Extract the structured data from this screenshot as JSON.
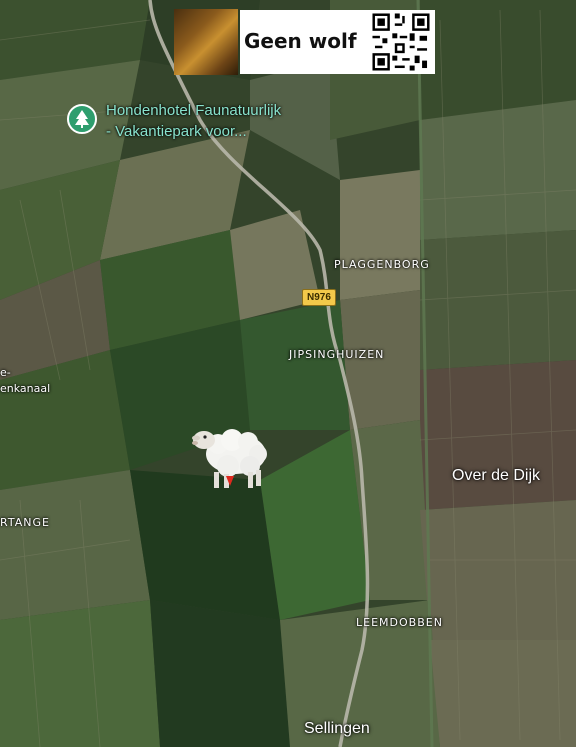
{
  "banner": {
    "text": "Geen wolf",
    "photo_icon": "forest-photo",
    "qr_icon": "qr-code-icon"
  },
  "poi": {
    "line1": "Hondenhotel Faunatuurlijk",
    "line2": "- Vakantiepark voor...",
    "icon": "tree-icon",
    "color": "#2e9e6e"
  },
  "road_shield": "N976",
  "places": {
    "plaggenborg": "PLAGGENBORG",
    "jipsinghuizen": "JIPSINGHUIZEN",
    "leemdobben": "LEEMDOBBEN",
    "ortange": "RTANGE",
    "kanaal_1": "e-",
    "kanaal_2": "enkanaal"
  },
  "towns": {
    "over_de_dijk": "Over de Dijk",
    "sellingen": "Sellingen"
  },
  "overlay": {
    "sheep_icon": "sheep-icon"
  }
}
